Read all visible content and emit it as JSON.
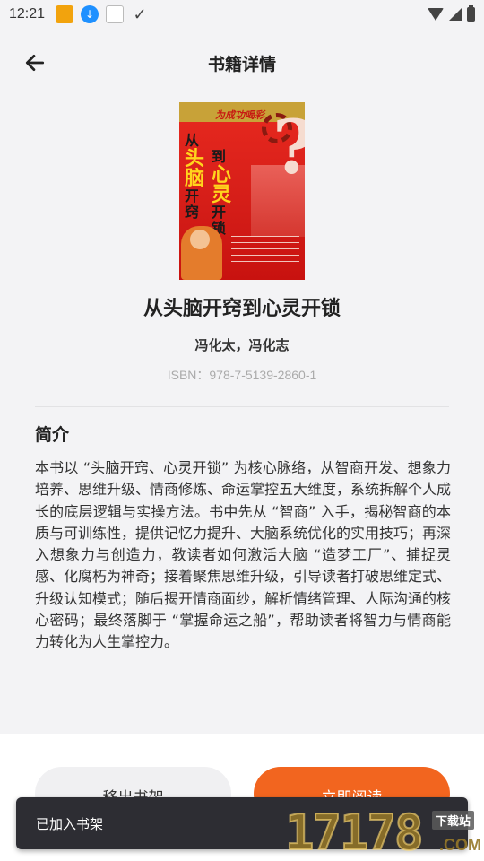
{
  "status_bar": {
    "time": "12:21",
    "icons": [
      "app-icon",
      "download-icon",
      "card-icon",
      "check-icon",
      "wifi-icon",
      "signal-icon",
      "battery-icon"
    ]
  },
  "header": {
    "title": "书籍详情",
    "back_icon": "arrow-left-icon"
  },
  "book": {
    "cover": {
      "slogan": "为成功喝彩",
      "title_left": [
        "从",
        "头",
        "脑",
        "开",
        "窍"
      ],
      "title_right": [
        "到",
        "心",
        "灵",
        "开",
        "锁"
      ]
    },
    "title": "从头脑开窍到心灵开锁",
    "author": "冯化太，冯化志",
    "isbn": "ISBN：978-7-5139-2860-1"
  },
  "intro": {
    "heading": "简介",
    "text": "本书以 “头脑开窍、心灵开锁” 为核心脉络，从智商开发、想象力培养、思维升级、情商修炼、命运掌控五大维度，系统拆解个人成长的底层逻辑与实操方法。书中先从 “智商” 入手，揭秘智商的本质与可训练性，提供记忆力提升、大脑系统优化的实用技巧；再深入想象力与创造力，教读者如何激活大脑 “造梦工厂”、捕捉灵感、化腐朽为神奇；接着聚焦思维升级，引导读者打破思维定式、升级认知模式；随后揭开情商面纱，解析情绪管理、人际沟通的核心密码；最终落脚于 “掌握命运之船”，帮助读者将智力与情商能力转化为人生掌控力。"
  },
  "actions": {
    "remove_label": "移出书架",
    "read_label": "立即阅读"
  },
  "toast": {
    "message": "已加入书架"
  },
  "watermark": {
    "number": "17178",
    "tag": "下载站",
    "suffix": ".COM"
  },
  "colors": {
    "accent": "#f2651f",
    "background": "#f3f3f5",
    "toast_bg": "#2d2d33"
  }
}
